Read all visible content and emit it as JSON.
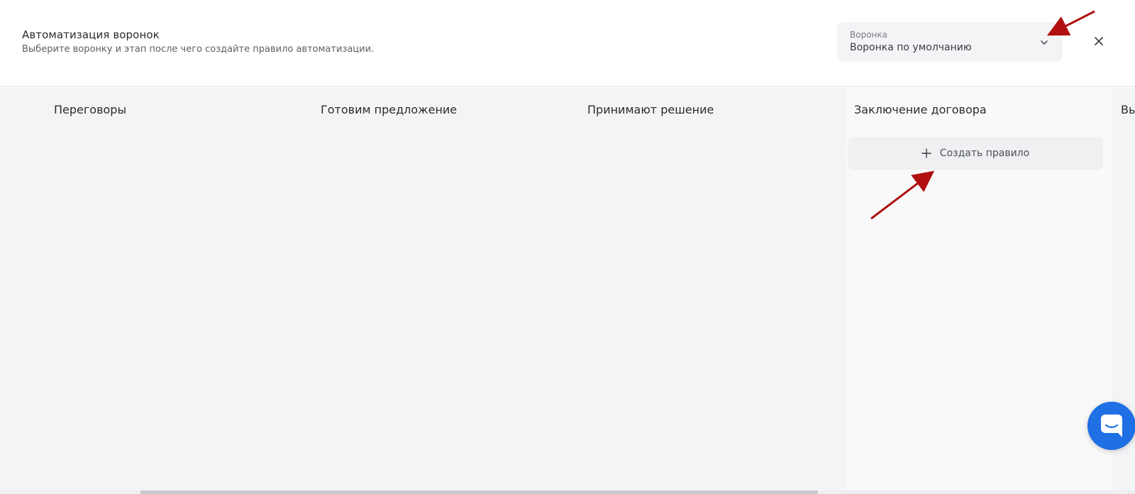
{
  "header": {
    "title": "Автоматизация воронок",
    "subtitle": "Выберите воронку и этап после чего создайте правило автоматизации.",
    "funnel_select": {
      "label": "Воронка",
      "value": "Воронка по умолчанию",
      "icon": "chevron-down-icon"
    },
    "close_icon": "close-icon"
  },
  "columns": [
    {
      "title": "Переговоры"
    },
    {
      "title": "Готовим предложение"
    },
    {
      "title": "Принимают решение"
    },
    {
      "title": "Заключение договора",
      "active": true,
      "create_rule_label": "Создать правило"
    },
    {
      "title": "Вы"
    }
  ],
  "colors": {
    "board_bg": "#f3f4f6",
    "active_column_bg": "#f9f9f9",
    "chat_button": "#1f6fe5",
    "annotation_arrow": "#b01010"
  },
  "chat_widget": {
    "icon": "chat-icon"
  }
}
